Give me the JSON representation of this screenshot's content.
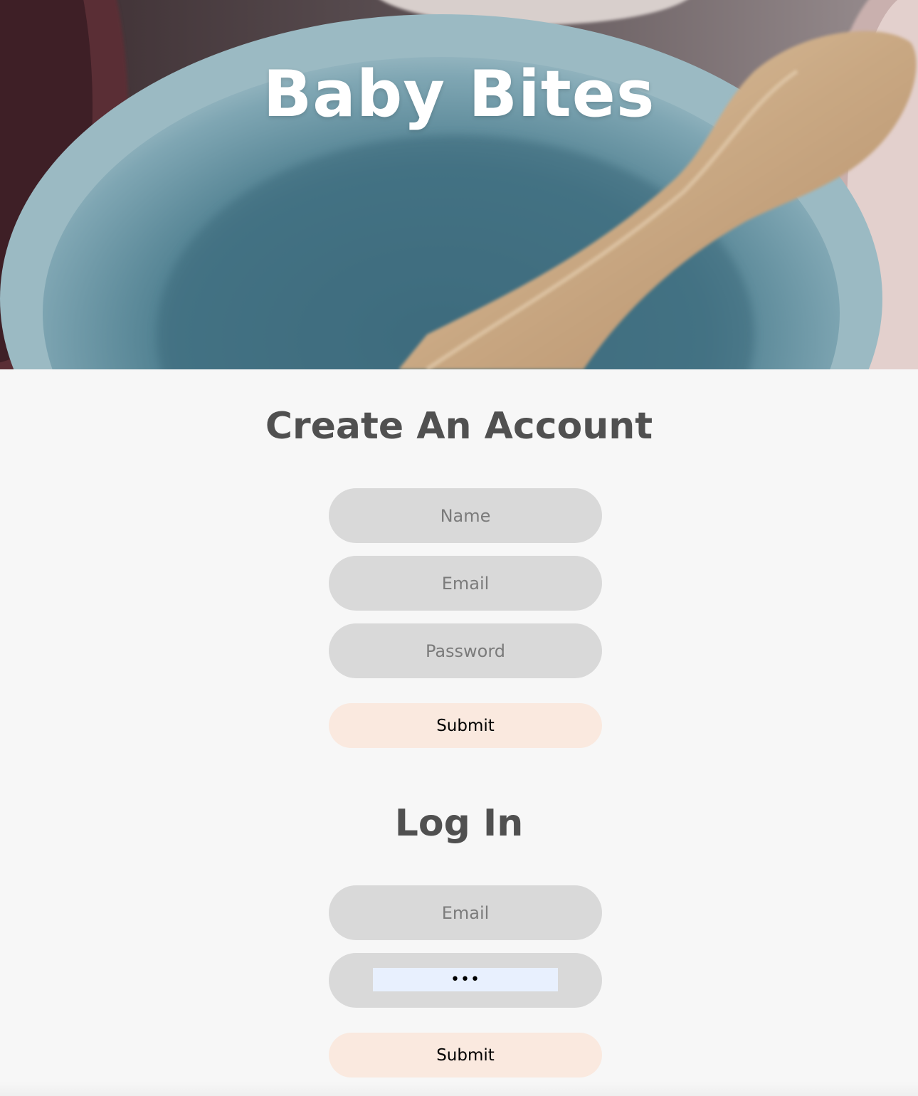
{
  "hero": {
    "title": "Baby Bites"
  },
  "signup": {
    "heading": "Create An Account",
    "name_placeholder": "Name",
    "email_placeholder": "Email",
    "password_placeholder": "Password",
    "submit_label": "Submit"
  },
  "login": {
    "heading": "Log In",
    "email_placeholder": "Email",
    "password_value": "•••",
    "submit_label": "Submit"
  },
  "colors": {
    "page_background": "#f7f7f7",
    "input_background": "#d9d9d9",
    "button_background": "#fae9df",
    "heading_text": "#505050",
    "autofill_highlight": "#e8f0fe"
  }
}
